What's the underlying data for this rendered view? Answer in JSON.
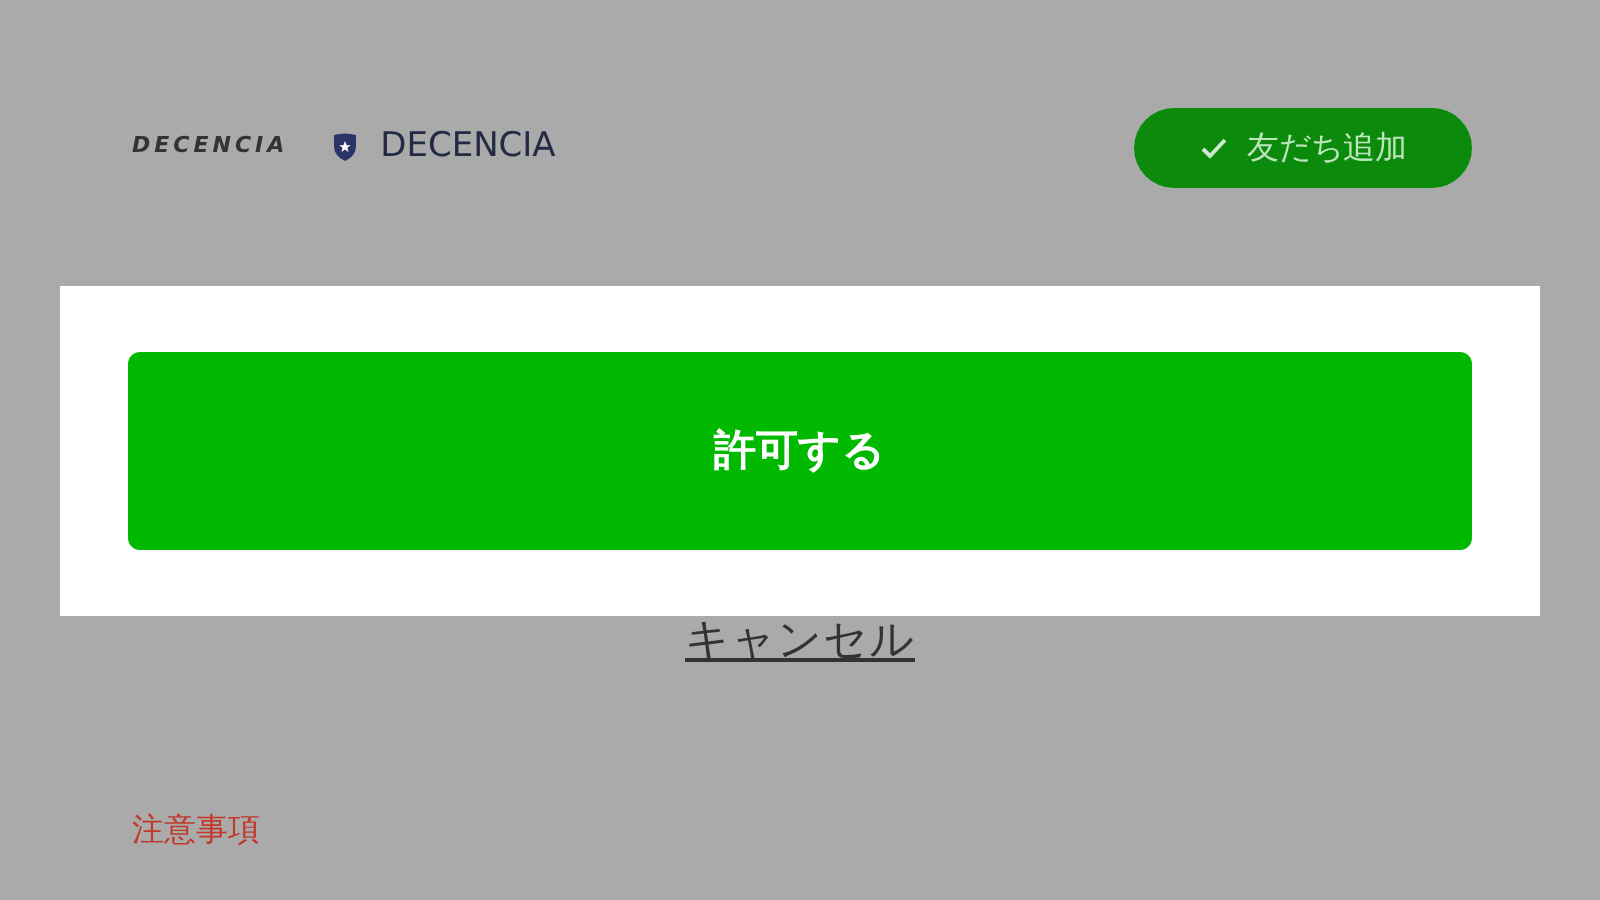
{
  "header": {
    "brand_logo": "DECENCIA",
    "account_name": "DECENCIA",
    "friend_button": {
      "label": "友だち追加",
      "added": true
    }
  },
  "allow_button": "許可する",
  "cancel_link": "キャンセル",
  "notes_heading": "注意事項"
}
